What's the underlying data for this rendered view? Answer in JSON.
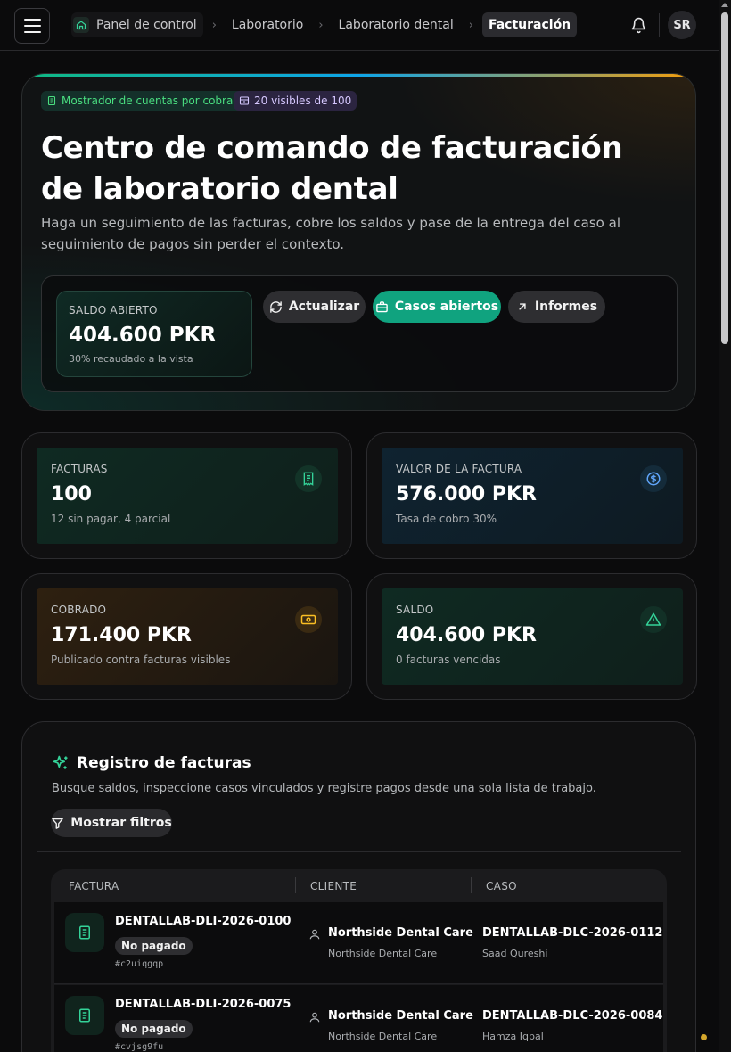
{
  "breadcrumb": [
    "Panel de control",
    "Laboratorio",
    "Laboratorio dental",
    "Facturación"
  ],
  "user": {
    "initials": "SR"
  },
  "hero": {
    "badge_receivables": "Mostrador de cuentas por cobrar",
    "badge_visible": "20 visibles de 100",
    "title": "Centro de comando de facturación de laboratorio dental",
    "description": "Haga un seguimiento de las facturas, cobre los saldos y pase de la entrega del caso al seguimiento de pagos sin perder el contexto.",
    "open_balance": {
      "label": "SALDO ABIERTO",
      "value": "404.600 PKR",
      "sub": "30% recaudado a la vista"
    },
    "buttons": {
      "refresh": "Actualizar",
      "open_cases": "Casos abiertos",
      "reports": "Informes"
    }
  },
  "stats": [
    {
      "label": "FACTURAS",
      "value": "100",
      "sub": "12 sin pagar, 4 parcial",
      "icon": "receipt-icon",
      "color": "#34d399"
    },
    {
      "label": "VALOR DE LA FACTURA",
      "value": "576.000 PKR",
      "sub": "Tasa de cobro 30%",
      "icon": "dollar-circle-icon",
      "color": "#60a5fa"
    },
    {
      "label": "COBRADO",
      "value": "171.400 PKR",
      "sub": "Publicado contra facturas visibles",
      "icon": "banknote-icon",
      "color": "#fbbf24"
    },
    {
      "label": "SALDO",
      "value": "404.600 PKR",
      "sub": "0 facturas vencidas",
      "icon": "warning-icon",
      "color": "#34d399"
    }
  ],
  "registry": {
    "title": "Registro de facturas",
    "description": "Busque saldos, inspeccione casos vinculados y registre pagos desde una sola lista de trabajo.",
    "filters_button": "Mostrar filtros",
    "columns": [
      "FACTURA",
      "CLIENTE",
      "CASO"
    ],
    "rows": [
      {
        "invoice": "DENTALLAB-DLI-2026-0100",
        "status": "No pagado",
        "hash": "#c2uiqgqp",
        "client": "Northside Dental Care",
        "client_sub": "Northside Dental Care",
        "case": "DENTALLAB-DLC-2026-0112",
        "case_sub": "Saad Qureshi"
      },
      {
        "invoice": "DENTALLAB-DLI-2026-0075",
        "status": "No pagado",
        "hash": "#cvjsg9fu",
        "client": "Northside Dental Care",
        "client_sub": "Northside Dental Care",
        "case": "DENTALLAB-DLC-2026-0084",
        "case_sub": "Hamza Iqbal"
      }
    ]
  }
}
